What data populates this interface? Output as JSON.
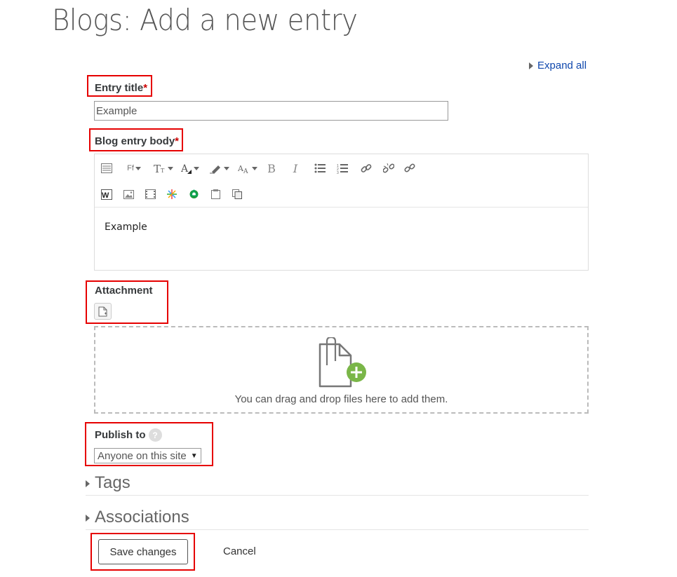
{
  "page": {
    "title": "Blogs: Add a new entry"
  },
  "form": {
    "expand_all": "Expand all",
    "entry_title": {
      "label": "Entry title",
      "required_marker": "*",
      "value": "Example"
    },
    "body": {
      "label": "Blog entry body",
      "required_marker": "*",
      "content": "Example",
      "toolbar": {
        "font_family_short": "Ff",
        "row1_icons": [
          "toolbar-toggle-icon",
          "font-family-icon",
          "font-size-icon",
          "font-color-icon",
          "highlight-icon",
          "text-direction-icon",
          "bold-icon",
          "italic-icon",
          "unordered-list-icon",
          "ordered-list-icon",
          "link-icon",
          "unlink-icon",
          "anchor-icon"
        ],
        "row2_icons": [
          "word-import-icon",
          "image-icon",
          "media-icon",
          "wiris-icon",
          "chem-icon",
          "paste-icon",
          "copy-icon"
        ]
      }
    },
    "attachment": {
      "label": "Attachment",
      "dropzone_text": "You can drag and drop files here to add them."
    },
    "publish": {
      "label": "Publish to",
      "help": "?",
      "selected": "Anyone on this site"
    },
    "sections": [
      {
        "title": "Tags"
      },
      {
        "title": "Associations"
      }
    ],
    "buttons": {
      "save": "Save changes",
      "cancel": "Cancel"
    }
  },
  "colors": {
    "highlight_box": "#e60000",
    "link": "#0f47ad",
    "required": "#cc0000",
    "dropzone_plus": "#7ab648"
  }
}
